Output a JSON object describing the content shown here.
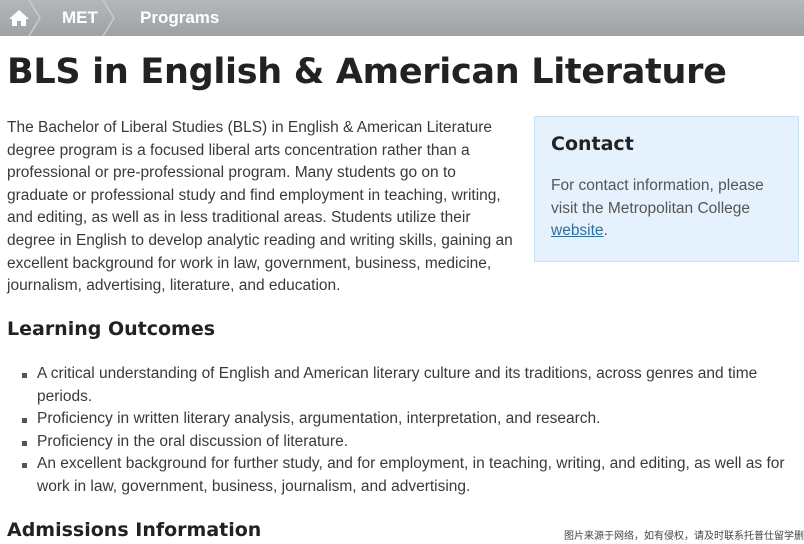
{
  "breadcrumb": {
    "home_icon": "home-icon",
    "items": [
      "MET",
      "Programs"
    ]
  },
  "page": {
    "title": "BLS in English & American Literature"
  },
  "intro": {
    "text": "The Bachelor of Liberal Studies (BLS) in English & American Literature degree program is a focused liberal arts concentration rather than a professional or pre-professional program. Many students go on to graduate or professional study and find employment in teaching, writing, and editing, as well as in less traditional areas. Students utilize their degree in English to develop analytic reading and writing skills, gaining an excellent background for work in law, government, business, medicine, journalism, advertising, literature, and education."
  },
  "contact": {
    "title": "Contact",
    "text_before_link": "For contact information, please visit the Metropolitan College ",
    "link_label": "website",
    "text_after_link": "."
  },
  "learning_outcomes": {
    "title": "Learning Outcomes",
    "items": [
      "A critical understanding of English and American literary culture and its traditions, across genres and time periods.",
      "Proficiency in written literary analysis, argumentation, interpretation, and research.",
      "Proficiency in the oral discussion of literature.",
      "An excellent background for further study, and for employment, in teaching, writing, and editing, as well as for work in law, government, business, journalism, and advertising."
    ]
  },
  "admissions": {
    "title": "Admissions Information"
  },
  "watermark": {
    "text": "图片来源于网络，如有侵权，请及时联系托普仕留学删"
  },
  "colors": {
    "breadcrumb_bg": "#a7abaf",
    "contact_bg": "#e5f2fd",
    "link": "#2f6f9f"
  }
}
